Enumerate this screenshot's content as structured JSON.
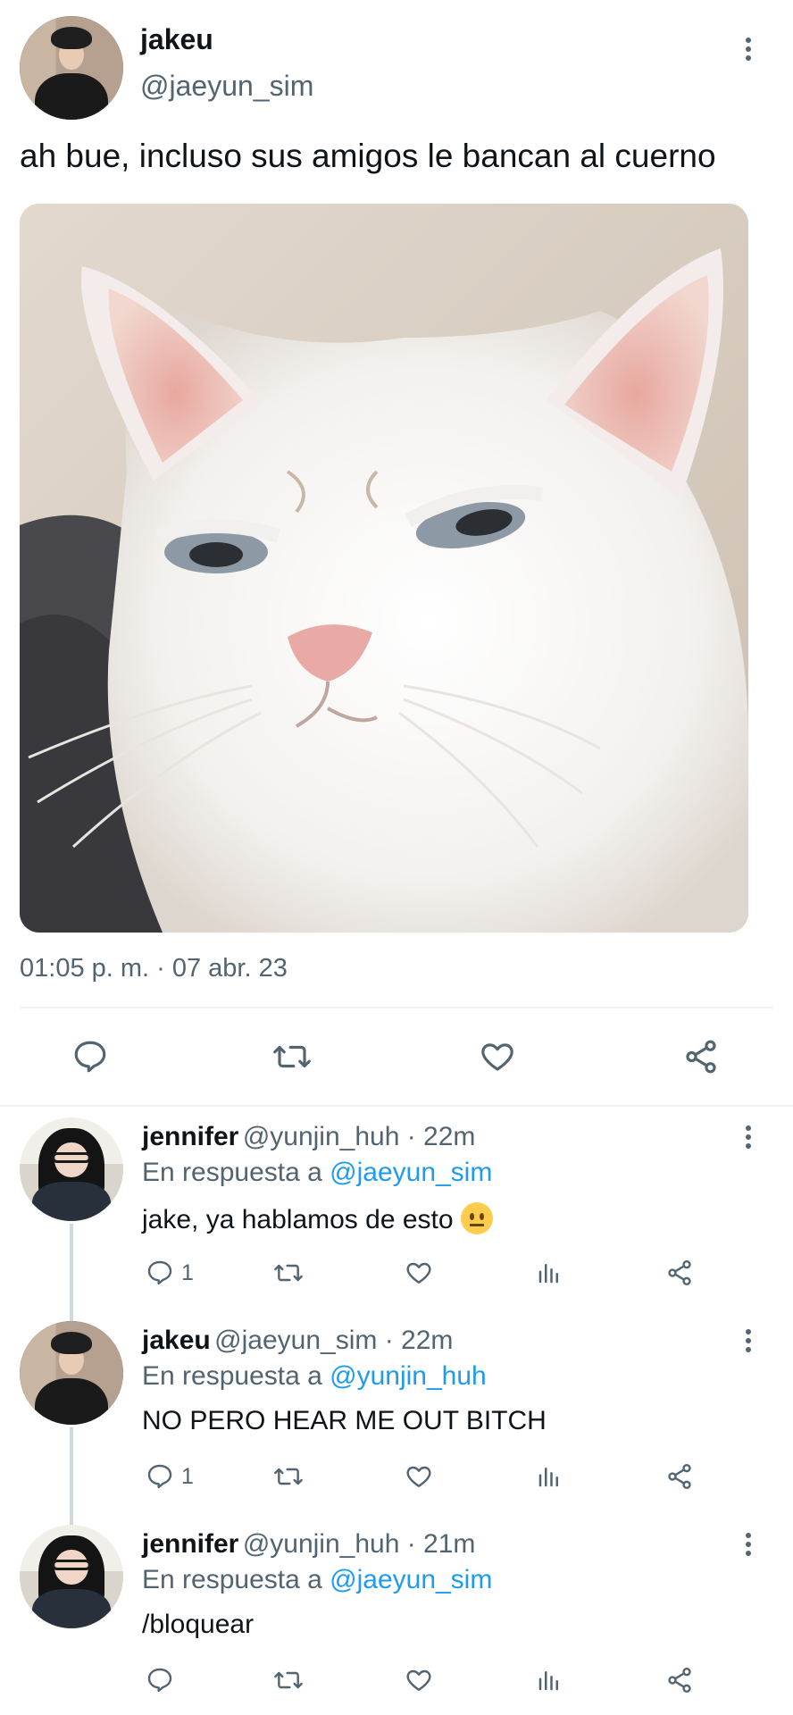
{
  "main_tweet": {
    "author_name": "jakeu",
    "author_handle": "@jaeyun_sim",
    "text": "ah bue, incluso sus amigos le bancan al cuerno",
    "timestamp": "01:05 p. m. · 07 abr. 23",
    "actions": [
      "reply-icon",
      "retweet-icon",
      "like-icon",
      "share-icon"
    ]
  },
  "replies": [
    {
      "name": "jennifer",
      "meta": "@yunjin_huh · 22m",
      "reply_prefix": "En respuesta a",
      "reply_mention": "@jaeyun_sim",
      "text": "jake, ya hablamos de esto",
      "emoji": "neutral-face",
      "reply_count": "1"
    },
    {
      "name": "jakeu",
      "meta": "@jaeyun_sim · 22m",
      "reply_prefix": "En respuesta a",
      "reply_mention": "@yunjin_huh",
      "text": "NO PERO HEAR ME OUT BITCH",
      "reply_count": "1"
    },
    {
      "name": "jennifer",
      "meta": "@yunjin_huh · 21m",
      "reply_prefix": "En respuesta a",
      "reply_mention": "@jaeyun_sim",
      "text": "/bloquear",
      "reply_count": ""
    }
  ],
  "colors": {
    "text": "#0f1419",
    "secondary": "#536471",
    "link": "#1d9bf0",
    "divider": "#eff3f4"
  }
}
